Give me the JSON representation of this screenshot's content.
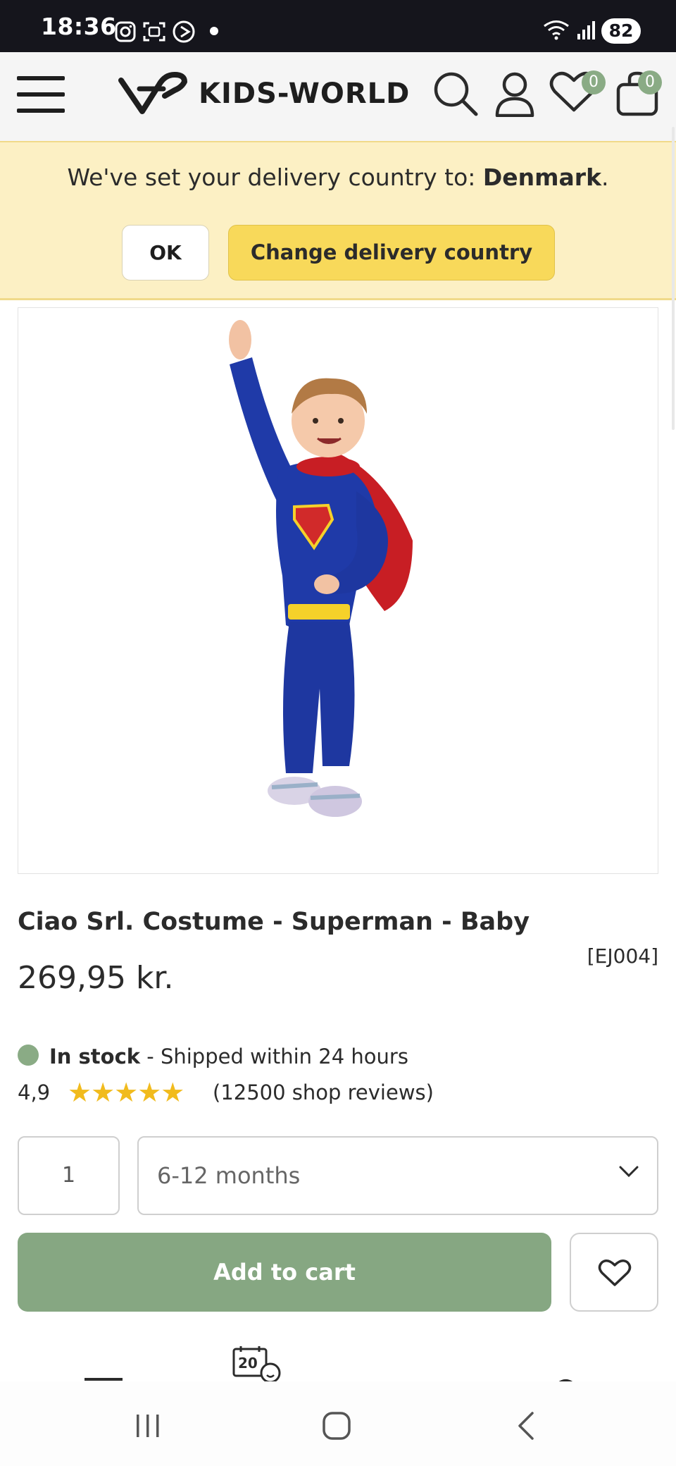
{
  "status_bar": {
    "time": "18:36",
    "battery": "82"
  },
  "header": {
    "brand": "KIDS-WORLD",
    "wishlist_count": "0",
    "cart_count": "0"
  },
  "delivery_banner": {
    "message_prefix": "We've set your delivery country to: ",
    "country": "Denmark",
    "message_suffix": ".",
    "ok_label": "OK",
    "change_label": "Change delivery country"
  },
  "product": {
    "title": "Ciao Srl. Costume - Superman - Baby",
    "sku": "[EJ004]",
    "price": "269,95 kr.",
    "stock_status": "In stock",
    "shipping_note": " - Shipped within 24 hours",
    "rating": "4,9",
    "rating_stars": "★★★★★",
    "review_count": "(12500 shop reviews)",
    "quantity": "1",
    "selected_size": "6-12 months",
    "add_to_cart_label": "Add to cart",
    "calendar_day": "20"
  },
  "colors": {
    "accent_green": "#86a782",
    "banner_bg": "#fcf0c4",
    "banner_button": "#f8d95a",
    "star": "#f1bb1d"
  },
  "icons": [
    "hamburger-menu-icon",
    "search-icon",
    "user-icon",
    "heart-icon",
    "bag-icon",
    "chevron-down-icon",
    "calendar-icon"
  ]
}
